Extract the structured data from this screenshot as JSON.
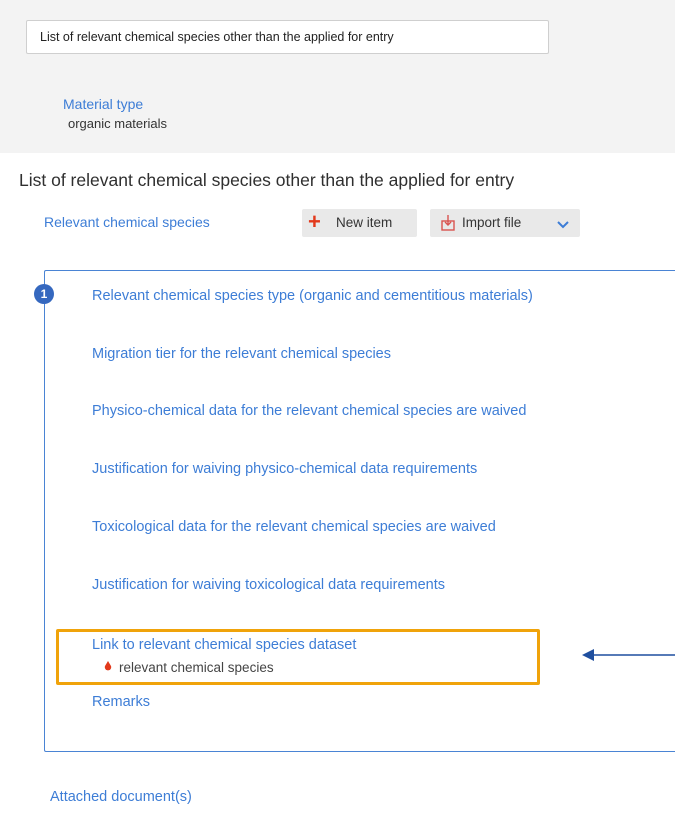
{
  "tab": {
    "label": "List of relevant chemical species other than the applied for entry"
  },
  "material": {
    "label": "Material type",
    "value": "organic materials"
  },
  "section": {
    "title": "List of relevant chemical species other than the applied for entry"
  },
  "relevant": {
    "label": "Relevant chemical species"
  },
  "toolbar": {
    "new_item": "New item",
    "import_file": "Import file"
  },
  "item": {
    "index": "1",
    "fields": [
      "Relevant chemical species type (organic and cementitious materials)",
      "Migration tier for the relevant chemical species",
      "Physico-chemical data for the relevant chemical species are waived",
      "Justification for waiving physico-chemical data requirements",
      "Toxicological data for the relevant chemical species are waived",
      "Justification for waiving toxicological data requirements"
    ],
    "link_label": "Link to relevant chemical species dataset",
    "link_value": "relevant chemical species",
    "remarks": "Remarks"
  },
  "attached": {
    "label": "Attached document(s)"
  },
  "colors": {
    "accent": "#3d7dd6",
    "highlight": "#f0a30a",
    "add": "#e2391b"
  }
}
